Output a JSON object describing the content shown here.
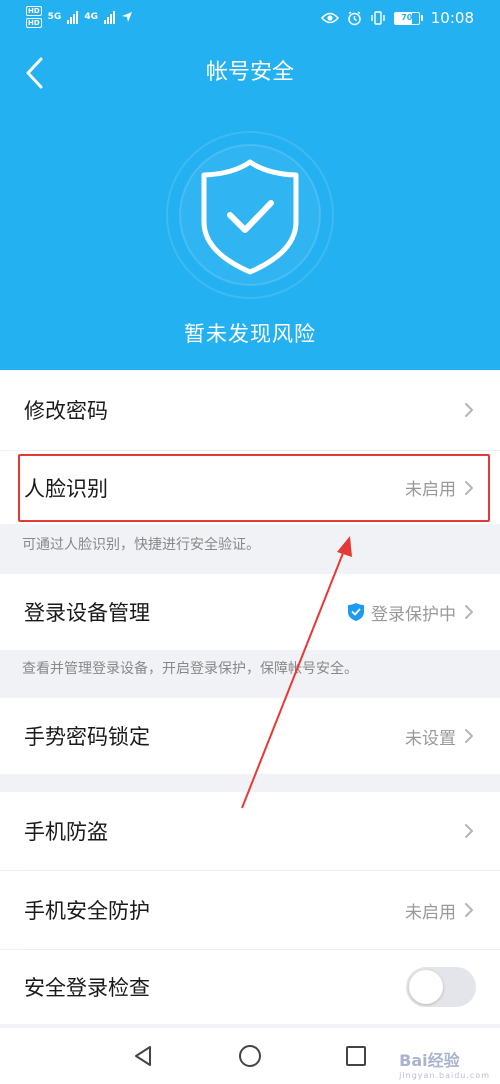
{
  "status_bar": {
    "hd_top": "HD",
    "hd_bottom": "HD",
    "net_5g": "5G",
    "net_4g": "4G",
    "battery": "70",
    "time": "10:08"
  },
  "header": {
    "title": "帐号安全",
    "risk_status": "暂未发现风险"
  },
  "items": {
    "change_password": {
      "label": "修改密码"
    },
    "face_recognition": {
      "label": "人脸识别",
      "status": "未启用",
      "description": "可通过人脸识别，快捷进行安全验证。"
    },
    "login_devices": {
      "label": "登录设备管理",
      "status": "登录保护中",
      "description": "查看并管理登录设备，开启登录保护，保障帐号安全。"
    },
    "gesture_lock": {
      "label": "手势密码锁定",
      "status": "未设置"
    },
    "anti_theft": {
      "label": "手机防盗"
    },
    "phone_protection": {
      "label": "手机安全防护",
      "status": "未启用"
    },
    "login_check": {
      "label": "安全登录检查",
      "enabled": false
    }
  },
  "watermark": {
    "text": "Bai经验",
    "sub": "jingyan.baidu.com"
  },
  "colors": {
    "header_bg": "#24b1f2",
    "highlight": "#e53935",
    "shield_badge": "#1e9bf0"
  },
  "icons": [
    "back-arrow-icon",
    "shield-check-icon",
    "chevron-right-icon",
    "shield-badge-icon",
    "nav-back-icon",
    "nav-home-icon",
    "nav-recent-icon"
  ]
}
